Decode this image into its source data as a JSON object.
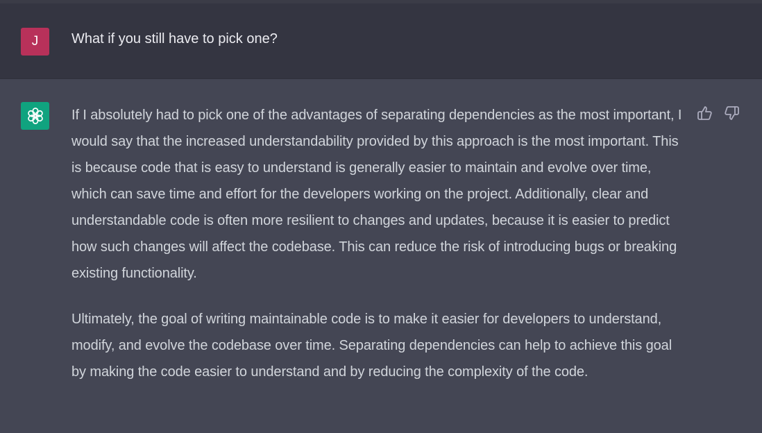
{
  "conversation": {
    "user_message": {
      "avatar_initial": "J",
      "avatar_color": "#b8315a",
      "text": "What if you still have to pick one?"
    },
    "assistant_message": {
      "avatar_icon": "openai-logo-icon",
      "avatar_color": "#10a37f",
      "paragraphs": [
        "If I absolutely had to pick one of the advantages of separating dependencies as the most important, I would say that the increased understandability provided by this approach is the most important. This is because code that is easy to understand is generally easier to maintain and evolve over time, which can save time and effort for the developers working on the project. Additionally, clear and understandable code is often more resilient to changes and updates, because it is easier to predict how such changes will affect the codebase. This can reduce the risk of introducing bugs or breaking existing functionality.",
        "Ultimately, the goal of writing maintainable code is to make it easier for developers to understand, modify, and evolve the codebase over time. Separating dependencies can help to achieve this goal by making the code easier to understand and by reducing the complexity of the code."
      ],
      "feedback_icons": [
        "thumbs-up-icon",
        "thumbs-down-icon"
      ]
    }
  },
  "colors": {
    "user_row_bg": "#343541",
    "assistant_row_bg": "#444654",
    "text_primary": "#ececf1",
    "text_secondary": "#d1d5db"
  }
}
